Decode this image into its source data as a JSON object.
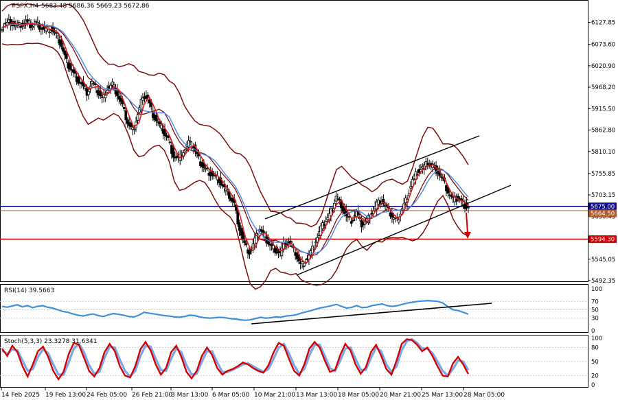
{
  "header": {
    "symbol": "#SPX,H4",
    "ohlc": "5683.48 5686.36 5669.23 5672.86"
  },
  "colors": {
    "bull_candle": "#000000",
    "bear_candle": "#000000",
    "bollinger": "#7b0c0c",
    "ma_fast": "#d91e1e",
    "ma_slow": "#4a86e8",
    "blue_line": "#0d0d8c",
    "red_line": "#d40000",
    "rsi_line": "#3d8fd9",
    "stoch_main": "#d40000",
    "stoch_signal": "#7aa7e8",
    "trendline": "#000000"
  },
  "chart_data": [
    {
      "type": "candlestick",
      "panel": "price",
      "title": "#SPX,H4",
      "header_values": {
        "open": 5683.48,
        "high": 5686.36,
        "low": 5669.23,
        "close": 5672.86
      },
      "ylim": [
        5470,
        6160
      ],
      "y_ticks": [
        6127.85,
        6073.6,
        6020.9,
        5968.2,
        5915.5,
        5862.8,
        5810.1,
        5755.85,
        5703.15,
        5650.45,
        5597.75,
        5545.05,
        5492.35
      ],
      "y_tick_labels": [
        "6127.85",
        "6073.60",
        "6020.90",
        "5968.20",
        "5915.50",
        "5862.80",
        "5810.10",
        "5755.85",
        "5703.15",
        "5650.45",
        "5597.75",
        "5545.05",
        "5492.35"
      ],
      "x_tick_labels": [
        "14 Feb 2025",
        "19 Feb 13:00",
        "24 Feb 05:00",
        "26 Feb 21:00",
        "3 Mar 13:00",
        "6 Mar 05:00",
        "10 Mar 21:00",
        "13 Mar 13:00",
        "18 Mar 05:00",
        "20 Mar 21:00",
        "25 Mar 13:00",
        "28 Mar 05:00"
      ],
      "price_path": [
        6115,
        6125,
        6130,
        6118,
        6122,
        6128,
        6120,
        6126,
        6115,
        6108,
        6112,
        6095,
        6070,
        6030,
        6010,
        5990,
        5975,
        5955,
        5980,
        5960,
        5940,
        5965,
        5975,
        5950,
        5920,
        5880,
        5860,
        5900,
        5950,
        5940,
        5900,
        5880,
        5860,
        5840,
        5800,
        5790,
        5810,
        5830,
        5820,
        5790,
        5770,
        5760,
        5750,
        5740,
        5720,
        5700,
        5680,
        5620,
        5580,
        5560,
        5590,
        5620,
        5600,
        5580,
        5570,
        5560,
        5590,
        5580,
        5560,
        5530,
        5540,
        5560,
        5590,
        5620,
        5640,
        5660,
        5700,
        5680,
        5650,
        5640,
        5660,
        5630,
        5640,
        5660,
        5680,
        5690,
        5670,
        5650,
        5640,
        5670,
        5700,
        5740,
        5760,
        5770,
        5780,
        5775,
        5760,
        5740,
        5710,
        5690,
        5695,
        5680,
        5672.86
      ],
      "levels": [
        {
          "label": "5675.00",
          "value": 5675.0,
          "color": "#0d0d8c"
        },
        {
          "label": "5664.50",
          "value": 5664.5,
          "color": "#b05a2a"
        },
        {
          "label": "5594.30",
          "value": 5594.3,
          "color": "#d40000"
        }
      ],
      "annotations": [
        "ascending channel",
        "downward arrow toward 5594.30"
      ]
    },
    {
      "type": "line",
      "panel": "indicator",
      "title": "RSI(14) 39.5663",
      "ylim": [
        0,
        100
      ],
      "y_tick_labels": [
        "100",
        "70",
        "50",
        "30",
        "0"
      ],
      "values": [
        58,
        56,
        59,
        62,
        57,
        60,
        55,
        58,
        60,
        56,
        54,
        50,
        46,
        44,
        40,
        37,
        35,
        38,
        40,
        36,
        34,
        38,
        41,
        39,
        37,
        34,
        33,
        37,
        44,
        42,
        40,
        38,
        36,
        35,
        33,
        32,
        34,
        37,
        36,
        33,
        31,
        30,
        31,
        32,
        31,
        29,
        28,
        26,
        25,
        26,
        29,
        32,
        30,
        31,
        33,
        32,
        35,
        36,
        38,
        42,
        45,
        48,
        52,
        55,
        57,
        60,
        63,
        58,
        54,
        56,
        60,
        55,
        56,
        60,
        62,
        64,
        60,
        58,
        60,
        63,
        66,
        68,
        70,
        71,
        72,
        71,
        70,
        66,
        57,
        50,
        48,
        44,
        39.57
      ]
    },
    {
      "type": "line",
      "panel": "indicator",
      "title": "Stoch(5,3,3) 23.3278 31.6341",
      "ylim": [
        0,
        100
      ],
      "y_tick_labels": [
        "100",
        "80",
        "50",
        "20",
        "0"
      ],
      "series": [
        {
          "name": "main",
          "values": [
            78,
            62,
            84,
            70,
            40,
            18,
            44,
            72,
            82,
            60,
            30,
            12,
            28,
            66,
            90,
            86,
            58,
            30,
            18,
            36,
            70,
            88,
            72,
            40,
            20,
            16,
            40,
            76,
            92,
            74,
            44,
            22,
            36,
            70,
            84,
            60,
            28,
            14,
            30,
            62,
            80,
            64,
            36,
            22,
            30,
            34,
            40,
            48,
            44,
            36,
            30,
            26,
            42,
            70,
            90,
            84,
            56,
            30,
            20,
            44,
            78,
            92,
            80,
            52,
            28,
            32,
            64,
            88,
            74,
            44,
            24,
            38,
            70,
            86,
            62,
            34,
            22,
            52,
            88,
            98,
            96,
            86,
            72,
            80,
            62,
            40,
            20,
            18,
            46,
            60,
            44,
            23.33
          ]
        },
        {
          "name": "signal",
          "values": [
            74,
            66,
            76,
            74,
            52,
            30,
            34,
            60,
            76,
            68,
            44,
            22,
            22,
            48,
            78,
            88,
            70,
            42,
            24,
            28,
            58,
            82,
            80,
            54,
            30,
            18,
            30,
            62,
            84,
            82,
            56,
            32,
            30,
            56,
            78,
            70,
            42,
            22,
            24,
            50,
            72,
            72,
            48,
            28,
            28,
            32,
            38,
            44,
            46,
            40,
            34,
            28,
            34,
            56,
            80,
            88,
            68,
            42,
            24,
            34,
            64,
            86,
            86,
            62,
            36,
            30,
            52,
            78,
            80,
            56,
            32,
            32,
            58,
            80,
            72,
            44,
            28,
            40,
            74,
            94,
            98,
            90,
            78,
            78,
            68,
            50,
            30,
            20,
            34,
            52,
            50,
            31.63
          ]
        }
      ]
    }
  ]
}
